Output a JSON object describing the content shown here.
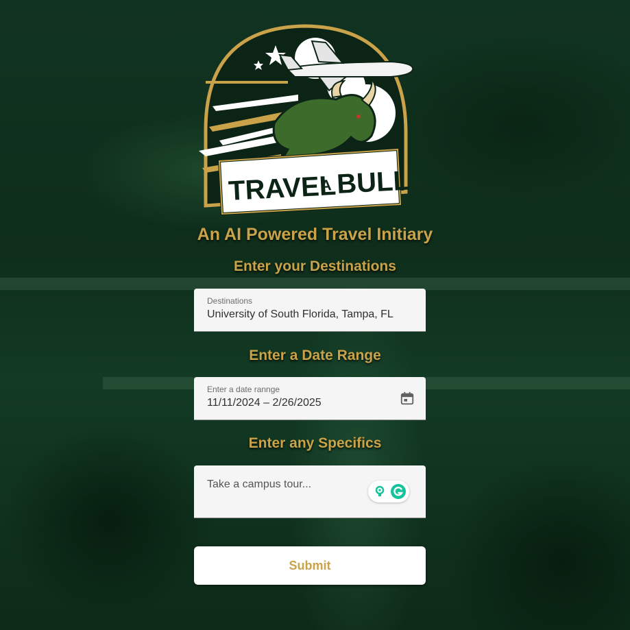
{
  "logo": {
    "text_travel": "TRAVEL",
    "text_a": "A",
    "text_bull": "BULL"
  },
  "title": "An AI Powered Travel Initiary",
  "destinations": {
    "heading": "Enter your Destinations",
    "label": "Destinations",
    "value": "University of South Florida, Tampa, FL"
  },
  "date_range": {
    "heading": "Enter a Date Range",
    "label": "Enter a date rannge",
    "value": "11/11/2024 – 2/26/2025",
    "icon": "calendar-icon"
  },
  "specifics": {
    "heading": "Enter any Specifics",
    "placeholder": "Take a campus tour...",
    "icons": [
      "lightbulb-icon",
      "grammarly-icon"
    ]
  },
  "submit_label": "Submit",
  "colors": {
    "gold": "#c9a24a",
    "forest_green": "#0f2b1a",
    "field_bg": "#f5f5f5",
    "grammarly_green": "#15c39a"
  }
}
